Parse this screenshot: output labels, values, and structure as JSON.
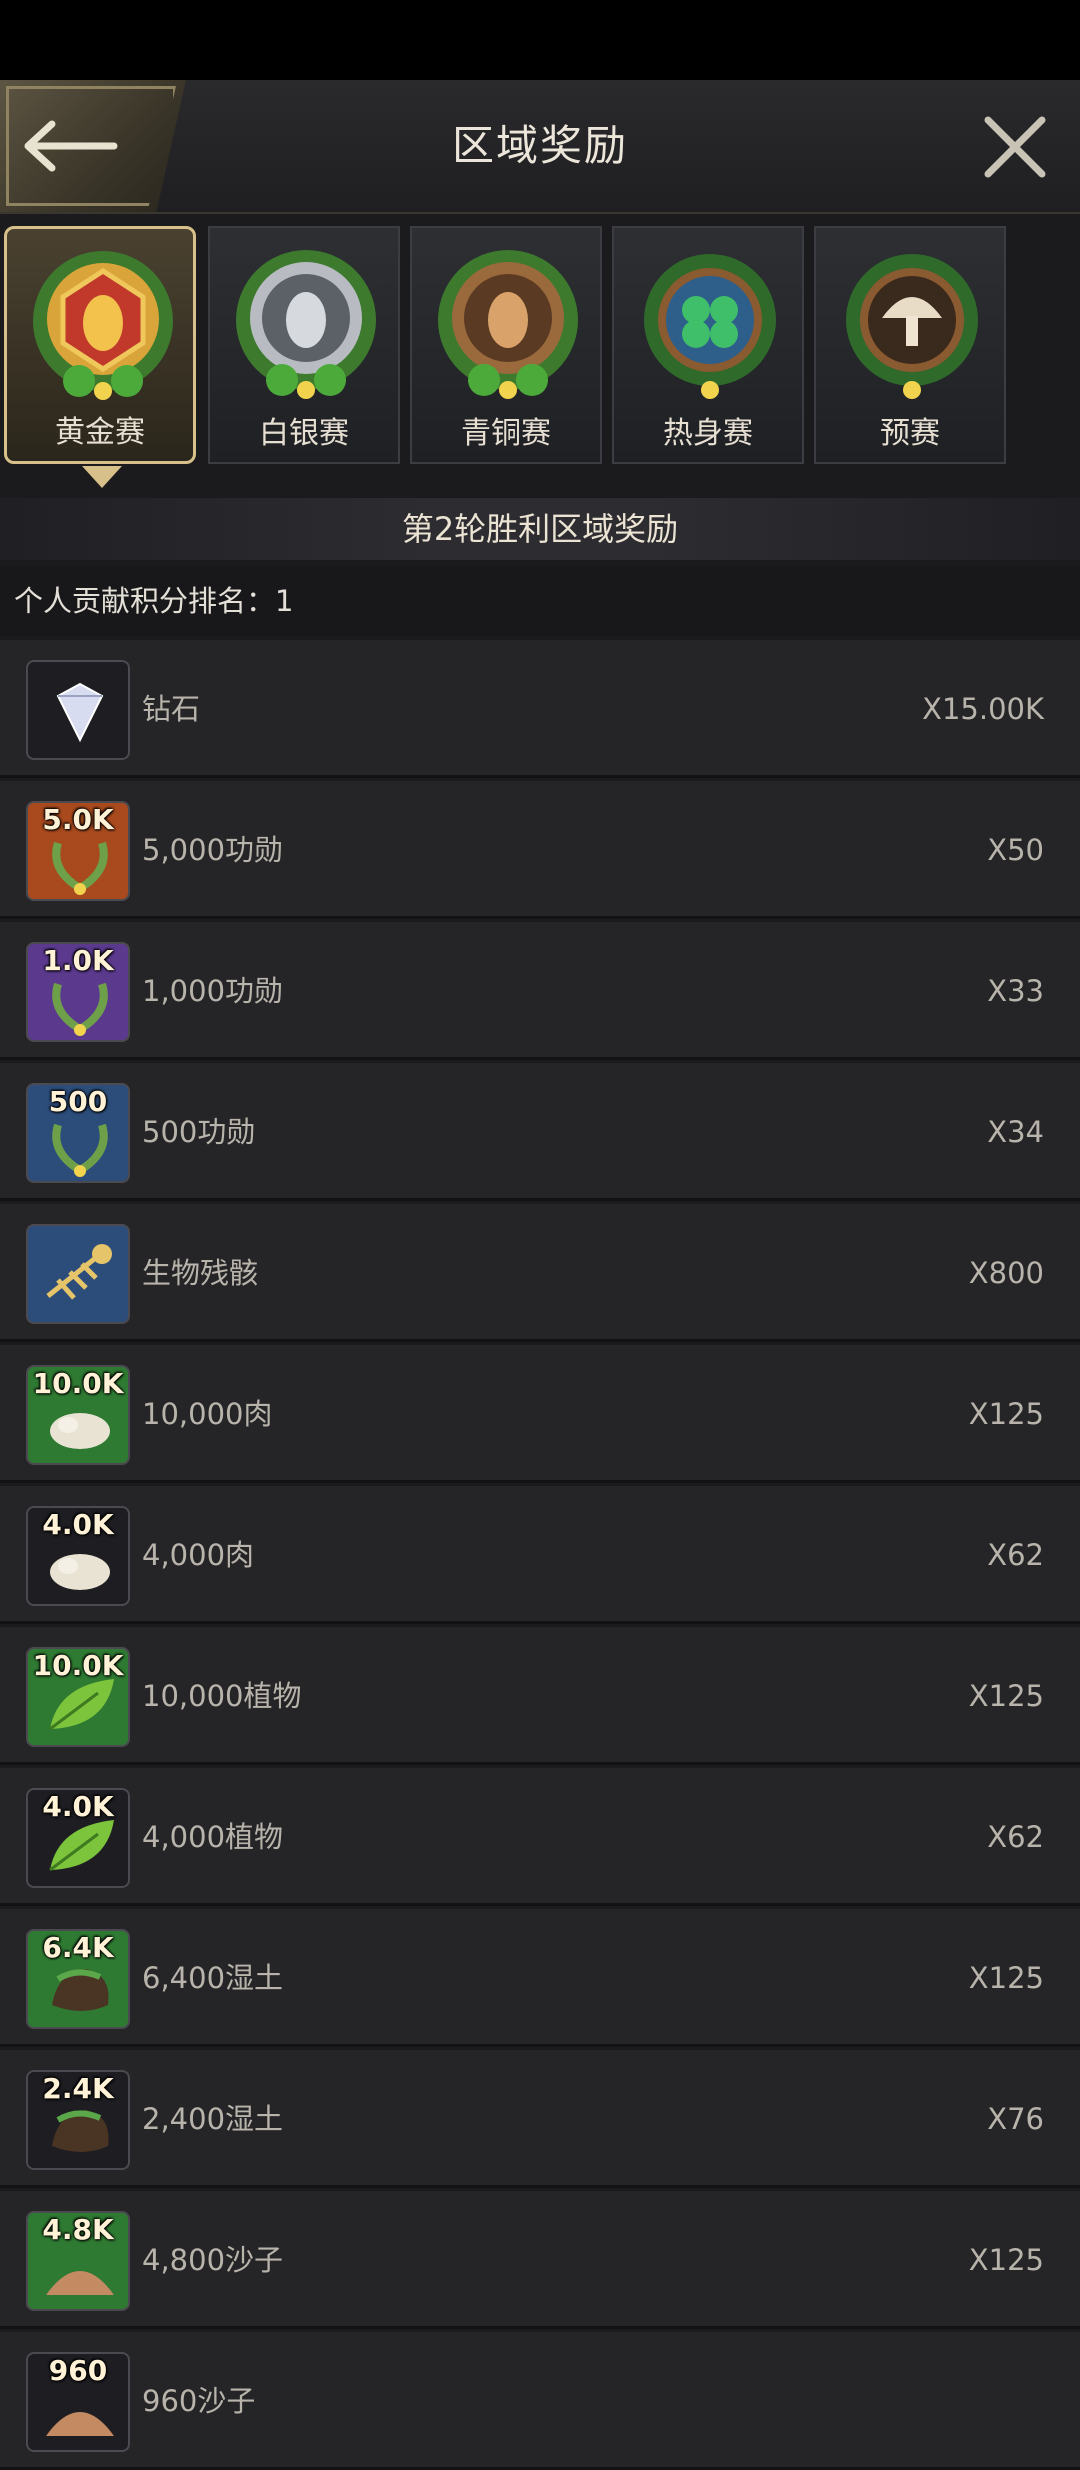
{
  "header": {
    "title": "区域奖励"
  },
  "tabs": [
    {
      "label": "黄金赛",
      "active": true
    },
    {
      "label": "白银赛",
      "active": false
    },
    {
      "label": "青铜赛",
      "active": false
    },
    {
      "label": "热身赛",
      "active": false
    },
    {
      "label": "预赛",
      "active": false
    }
  ],
  "banner": {
    "text": "第2轮胜利区域奖励"
  },
  "rank": {
    "label": "个人贡献积分排名：",
    "value": "1"
  },
  "rewards": [
    {
      "name": "钻石",
      "qty": "X15.00K",
      "badge": "",
      "icon": "diamond-icon",
      "bg": "#1d1d22"
    },
    {
      "name": "5,000功勋",
      "qty": "X50",
      "badge": "5.0K",
      "icon": "laurel-icon",
      "bg": "#a84a1e"
    },
    {
      "name": "1,000功勋",
      "qty": "X33",
      "badge": "1.0K",
      "icon": "laurel-icon",
      "bg": "#5b3a8e"
    },
    {
      "name": "500功勋",
      "qty": "X34",
      "badge": "500",
      "icon": "laurel-icon",
      "bg": "#2c4d7a"
    },
    {
      "name": "生物残骸",
      "qty": "X800",
      "badge": "",
      "icon": "fish-skeleton-icon",
      "bg": "#2c4d7a"
    },
    {
      "name": "10,000肉",
      "qty": "X125",
      "badge": "10.0K",
      "icon": "meat-grub-icon",
      "bg": "#2f7a32"
    },
    {
      "name": "4,000肉",
      "qty": "X62",
      "badge": "4.0K",
      "icon": "meat-grub-icon",
      "bg": "#1d1d22"
    },
    {
      "name": "10,000植物",
      "qty": "X125",
      "badge": "10.0K",
      "icon": "leaf-icon",
      "bg": "#2f7a32"
    },
    {
      "name": "4,000植物",
      "qty": "X62",
      "badge": "4.0K",
      "icon": "leaf-icon",
      "bg": "#1d1d22"
    },
    {
      "name": "6,400湿土",
      "qty": "X125",
      "badge": "6.4K",
      "icon": "soil-icon",
      "bg": "#2f7a32"
    },
    {
      "name": "2,400湿土",
      "qty": "X76",
      "badge": "2.4K",
      "icon": "soil-icon",
      "bg": "#1d1d22"
    },
    {
      "name": "4,800沙子",
      "qty": "X125",
      "badge": "4.8K",
      "icon": "sand-icon",
      "bg": "#2f7a32"
    },
    {
      "name": "960沙子",
      "qty": "",
      "badge": "960",
      "icon": "sand-icon",
      "bg": "#1d1d22"
    }
  ]
}
